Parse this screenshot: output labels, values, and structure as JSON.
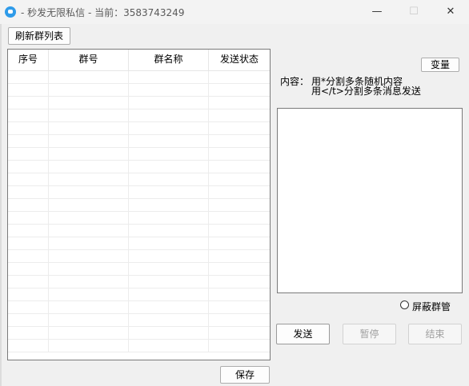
{
  "window": {
    "title": "- 秒发无限私信 - 当前：3583743249",
    "minimize_glyph": "—",
    "maximize_glyph": "☐",
    "close_glyph": "✕"
  },
  "toolbar": {
    "refresh_label": "刷新群列表"
  },
  "table": {
    "columns": [
      "序号",
      "群号",
      "群名称",
      "发送状态"
    ],
    "rows": []
  },
  "content": {
    "label": "内容：",
    "hint_line1": "用*分割多条随机内容",
    "hint_line2": "用</t>分割多条消息发送",
    "variable_button": "变量",
    "value": ""
  },
  "options": {
    "shield_admin_label": "屏蔽群管",
    "shield_admin_checked": false
  },
  "actions": {
    "send_label": "发送",
    "pause_label": "暂停",
    "end_label": "结束",
    "save_label": "保存"
  }
}
